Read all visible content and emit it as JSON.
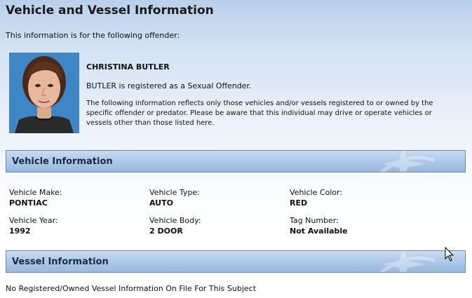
{
  "page": {
    "title": "Vehicle and Vessel Information"
  },
  "intro": "This information is for the following offender:",
  "offender": {
    "name": "CHRISTINA BUTLER",
    "registration": "BUTLER is registered as a Sexual Offender.",
    "disclaimer": "The following information reflects only those vehicles and/or vessels registered to or owned by the specific offender or predator. Please be aware that this individual may drive or operate vehicles or vessels other than those listed here."
  },
  "vehicle_section": {
    "title": "Vehicle Information",
    "fields": {
      "make": {
        "label": "Vehicle Make:",
        "value": "PONTIAC"
      },
      "type": {
        "label": "Vehicle Type:",
        "value": "AUTO"
      },
      "color": {
        "label": "Vehicle Color:",
        "value": "RED"
      },
      "year": {
        "label": "Vehicle Year:",
        "value": "1992"
      },
      "body": {
        "label": "Vehicle Body:",
        "value": "2 DOOR"
      },
      "tag": {
        "label": "Tag Number:",
        "value": "Not Available"
      }
    }
  },
  "vessel_section": {
    "title": "Vessel Information",
    "empty_message": "No Registered/Owned Vessel Information On File For This Subject"
  },
  "icons": {
    "header_mark": "compass-star-icon",
    "cursor": "mouse-pointer-icon"
  },
  "colors": {
    "header_bg": "#a9c5e7",
    "header_border": "#6f88a7",
    "photo_bg": "#3f86c7"
  }
}
